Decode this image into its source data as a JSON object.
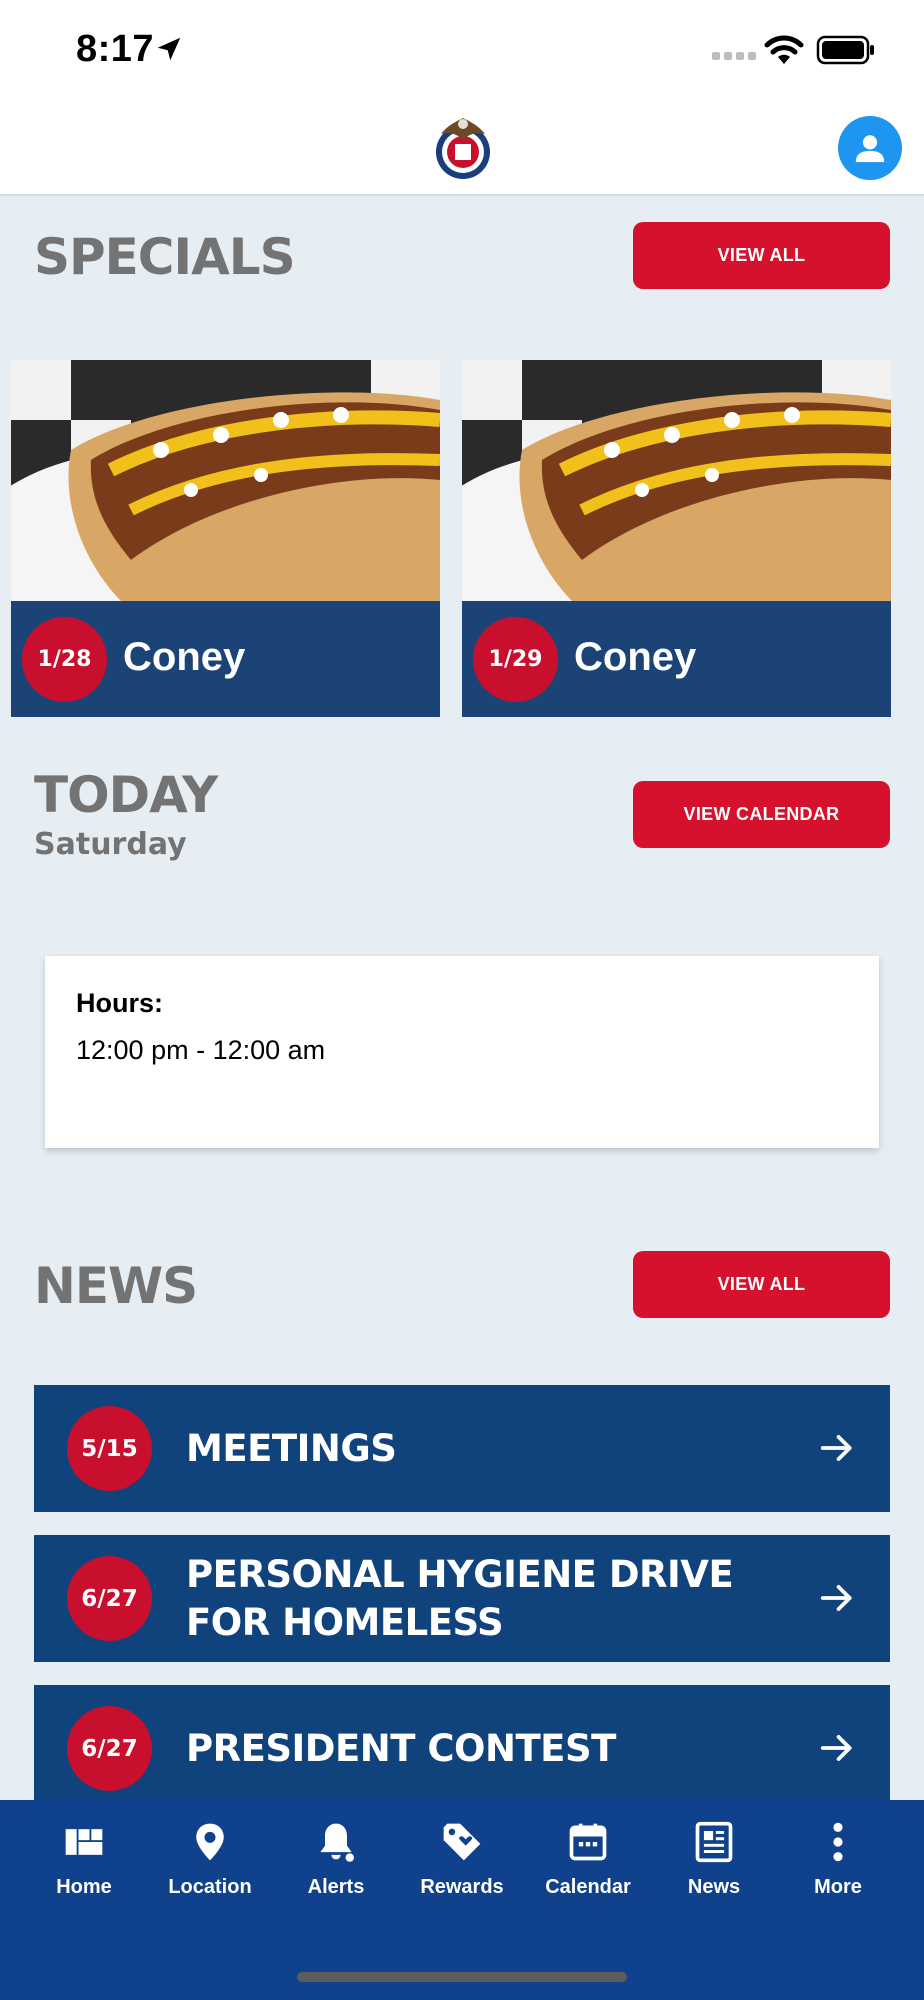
{
  "status_bar": {
    "time": "8:17"
  },
  "header": {
    "logo_icon": "eagle-logo-icon",
    "profile_icon": "user-icon"
  },
  "specials": {
    "title": "SPECIALS",
    "view_all": "VIEW ALL",
    "items": [
      {
        "date": "1/28",
        "name": "Coney"
      },
      {
        "date": "1/29",
        "name": "Coney"
      }
    ]
  },
  "today": {
    "title": "TODAY",
    "day": "Saturday",
    "view_calendar": "VIEW CALENDAR",
    "hours_label": "Hours:",
    "hours_value": "12:00 pm - 12:00 am"
  },
  "news": {
    "title": "NEWS",
    "view_all": "VIEW ALL",
    "items": [
      {
        "date": "5/15",
        "title": "MEETINGS"
      },
      {
        "date": "6/27",
        "title_line1": "PERSONAL HYGIENE DRIVE",
        "title_line2": "FOR HOMELESS"
      },
      {
        "date": "6/27",
        "title": "PRESIDENT CONTEST"
      }
    ]
  },
  "tab_bar": {
    "items": [
      {
        "label": "Home",
        "icon": "dashboard-icon"
      },
      {
        "label": "Location",
        "icon": "map-pin-icon"
      },
      {
        "label": "Alerts",
        "icon": "bell-icon"
      },
      {
        "label": "Rewards",
        "icon": "tag-icon"
      },
      {
        "label": "Calendar",
        "icon": "calendar-icon"
      },
      {
        "label": "News",
        "icon": "newspaper-icon"
      },
      {
        "label": "More",
        "icon": "more-vertical-icon"
      }
    ]
  },
  "colors": {
    "accent_red": "#d5112d",
    "navy": "#10437c",
    "tab_bar": "#0f418c",
    "background": "#e6eef4",
    "profile_blue": "#1e96f0"
  }
}
